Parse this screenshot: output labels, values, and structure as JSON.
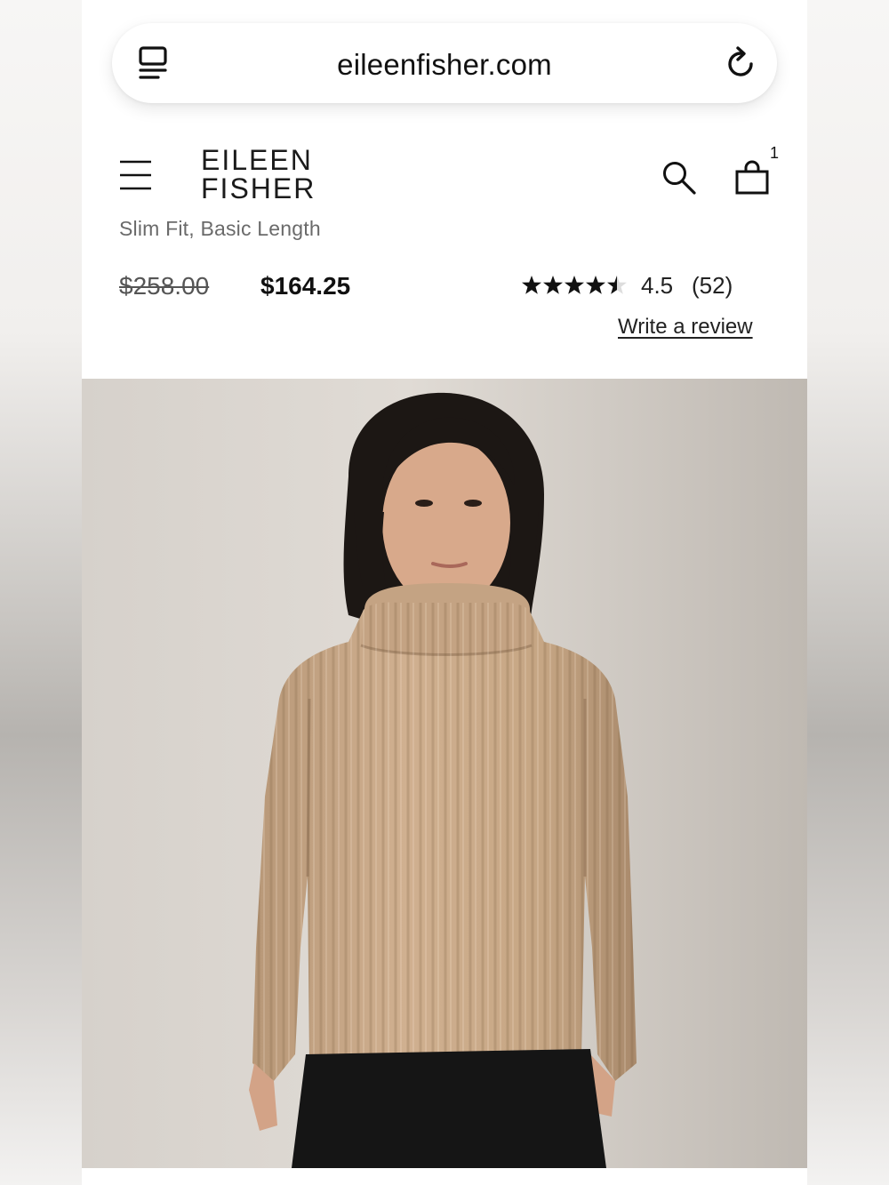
{
  "browser": {
    "url": "eileenfisher.com",
    "icons": {
      "tabs": "tabs-icon",
      "reload": "reload-icon"
    }
  },
  "header": {
    "brand_line1": "EILEEN",
    "brand_line2": "FISHER",
    "icons": {
      "menu": "menu-icon",
      "search": "search-icon",
      "bag": "shopping-bag-icon"
    },
    "bag_count": "1"
  },
  "product": {
    "subtitle": "Slim Fit, Basic Length",
    "original_price": "$258.00",
    "sale_price": "$164.25",
    "rating": {
      "stars_value": 4.5,
      "stars_max": 5,
      "value_text": "4.5",
      "count_text": "(52)"
    },
    "write_review_label": "Write a review",
    "image": "product-photo-model-ribbed-turtleneck"
  },
  "colors": {
    "text_primary": "#111111",
    "text_secondary": "#6a6a6a",
    "sweater": "#c9a985",
    "backdrop": "#d8d3cd"
  }
}
